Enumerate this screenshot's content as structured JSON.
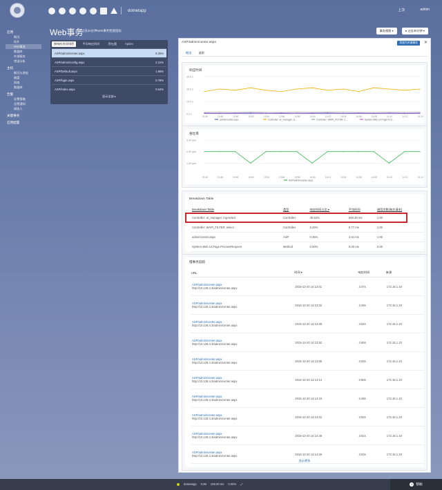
{
  "top": {
    "app_selector": "dotnetapp",
    "right1": "上次",
    "right2": "admin"
  },
  "sidebar": [
    {
      "head": "应用",
      "subs": [
        "概况",
        "拓扑",
        "Web事务",
        "数据库",
        "外部服务",
        "错误分析"
      ]
    },
    {
      "head": "主机",
      "subs": [
        "概况与进程",
        "磁盘",
        "网络",
        "数据库"
      ]
    },
    {
      "head": "告警",
      "subs": [
        "告警策略",
        "告警通知",
        "接收人"
      ]
    },
    {
      "head": "关键事务",
      "subs": []
    },
    {
      "head": "应用配置",
      "subs": []
    }
  ],
  "page": {
    "title": "Web事务",
    "subtitle": "过去30分钟Web事务性能指标",
    "btn_view": "事务视图 ▾",
    "btn_time": "● 过去30分钟 ▾"
  },
  "tx_panel": {
    "tabs": [
      "按响应时间排序",
      "平均响应时间",
      "吞吐量",
      "Apdex"
    ],
    "rows": [
      {
        "name": "ASP/admin/center.aspx",
        "value": "9.25%"
      },
      {
        "name": "ASP/admin/config.aspx",
        "value": "2.31%"
      },
      {
        "name": "ASP/Default.aspx",
        "value": "1.86%"
      },
      {
        "name": "ASP/login.aspx",
        "value": "0.78%"
      },
      {
        "name": "ASP/index.aspx",
        "value": "0.54%"
      }
    ],
    "more": "显示全部 ▸"
  },
  "main": {
    "header": "ASP/admin/center.aspx",
    "header_btn": "添加为关键事务",
    "tabs": [
      "概览",
      "追踪"
    ],
    "resp_title": "响应时间",
    "tput_title": "吞吐率",
    "bt_title": "Breakdown Table",
    "bt_headers": [
      "Breakdown Table",
      "类型",
      "响应时间占比 ▾",
      "平均时间",
      "调用次数(每次请求)"
    ],
    "bt_rows": [
      [
        "Controller: ar_manager: log-select",
        "Controller",
        "40.53%",
        "658.39 ms",
        "1.00"
      ],
      [
        "Controller: WAPI_FILTER: select",
        "Controller",
        "6.25%",
        "8.77 ms",
        "1.00"
      ],
      [
        "admin/center.aspx",
        "ASP",
        "0.36%",
        "3.64 ms",
        "1.00"
      ],
      [
        "System.Web.UI.Page.ProcessRequest",
        "Method",
        "0.00%",
        "0.00 ms",
        "0.00"
      ]
    ],
    "cl_title": "慢事务追踪",
    "cl_headers": [
      "URL",
      "时间 ▾",
      "响应时间",
      "来源"
    ],
    "cl_rows": [
      {
        "url": "ASP/admin/center.aspx",
        "detail": "http://10.128.4.3/admin/center.aspx",
        "time": "2015-12-20 14:13:01",
        "resp": "3.47s",
        "src": "172.16.1.10"
      },
      {
        "url": "ASP/admin/center.aspx",
        "detail": "http://10.128.4.3/admin/center.aspx",
        "time": "2015-12-20 14:13:22",
        "resp": "3.49s",
        "src": "172.16.1.10"
      },
      {
        "url": "ASP/admin/center.aspx",
        "detail": "http://10.128.4.3/admin/center.aspx",
        "time": "2015-12-20 14:13:28",
        "resp": "3.54s",
        "src": "172.16.1.10"
      },
      {
        "url": "ASP/admin/center.aspx",
        "detail": "http://10.128.4.3/admin/center.aspx",
        "time": "2015-12-20 14:13:52",
        "resp": "3.50s",
        "src": "172.16.1.10"
      },
      {
        "url": "ASP/admin/center.aspx",
        "detail": "http://10.128.4.3/admin/center.aspx",
        "time": "2015-12-20 14:13:55",
        "resp": "3.53s",
        "src": "172.16.1.10"
      },
      {
        "url": "ASP/admin/center.aspx",
        "detail": "http://10.128.4.3/admin/center.aspx",
        "time": "2015-12-20 14:14:14",
        "resp": "3.50s",
        "src": "172.16.1.10"
      },
      {
        "url": "ASP/admin/center.aspx",
        "detail": "http://10.128.4.3/admin/center.aspx",
        "time": "2015-12-20 14:14:16",
        "resp": "3.49s",
        "src": "172.16.1.10"
      },
      {
        "url": "ASP/admin/center.aspx",
        "detail": "http://10.128.4.3/admin/center.aspx",
        "time": "2015-12-20 14:14:22",
        "resp": "3.52s",
        "src": "172.16.1.10"
      },
      {
        "url": "ASP/admin/center.aspx",
        "detail": "http://10.128.4.3/admin/center.aspx",
        "time": "2015-12-20 14:14:28",
        "resp": "3.51s",
        "src": "172.16.1.10"
      },
      {
        "url": "ASP/admin/center.aspx",
        "detail": "http://10.128.4.3/admin/center.aspx",
        "time": "2015-12-20 14:14:29",
        "resp": "3.53s",
        "src": "172.16.1.10"
      }
    ],
    "cl_more": "显示更多"
  },
  "status": {
    "app": "dotnetapp",
    "apdex": "0.98",
    "resp": "105.00 ms",
    "err": "0.00%",
    "right": "帮助"
  },
  "chart_data": [
    {
      "type": "line",
      "title": "响应时间",
      "x": [
        "13:46",
        "13:48",
        "13:50",
        "13:52",
        "13:54",
        "13:56",
        "13:58",
        "14:00",
        "14:02",
        "14:04",
        "14:06",
        "14:08",
        "14:10",
        "14:12",
        "14:14"
      ],
      "ylim": [
        0,
        30
      ],
      "yticks": [
        "0.0 s",
        "10.0 s",
        "20.0 s",
        "30.0 s"
      ],
      "series": [
        {
          "name": "admin/center.aspx",
          "color": "#3b6fc0",
          "values": [
            0.3,
            0.2,
            0.3,
            0.2,
            0.3,
            0.2,
            0.3,
            0.2,
            0.3,
            0.2,
            0.3,
            0.2,
            0.3,
            0.2,
            0.3
          ]
        },
        {
          "name": "Controller: ar_manager: lo...",
          "color": "#f0b400",
          "values": [
            18,
            20,
            19,
            21,
            19,
            18,
            20,
            21,
            19,
            20,
            18,
            21,
            20,
            19,
            20
          ]
        },
        {
          "name": "Controller: WAPI_FILTER: s...",
          "color": "#9aa",
          "values": [
            1.2,
            1.3,
            1.1,
            1.4,
            1.2,
            1.1,
            1.3,
            1.2,
            1.4,
            1.3,
            1.2,
            1.1,
            1.3,
            1.2,
            1.3
          ]
        },
        {
          "name": "System.Web.UI.Page.Proc...",
          "color": "#c05ad0",
          "values": [
            0.6,
            0.5,
            0.6,
            0.7,
            0.5,
            0.6,
            0.5,
            0.6,
            0.7,
            0.5,
            0.6,
            0.5,
            0.6,
            0.5,
            0.6
          ]
        }
      ]
    },
    {
      "type": "line",
      "title": "吞吐率",
      "x": [
        "13:46",
        "13:48",
        "13:50",
        "13:52",
        "13:54",
        "13:56",
        "13:58",
        "14:00",
        "14:02",
        "14:04",
        "14:06",
        "14:08",
        "14:10",
        "14:12",
        "14:14"
      ],
      "ylim": [
        0,
        3
      ],
      "yticks": [
        "1.00 rpm",
        "2.00 rpm",
        "3.00 rpm"
      ],
      "series": [
        {
          "name": "ASP/admin/center.aspx",
          "color": "#3fbb55",
          "values": [
            2,
            2,
            2,
            1,
            2,
            2,
            2,
            1,
            2,
            2,
            2,
            2,
            1,
            2,
            2
          ]
        }
      ]
    }
  ]
}
